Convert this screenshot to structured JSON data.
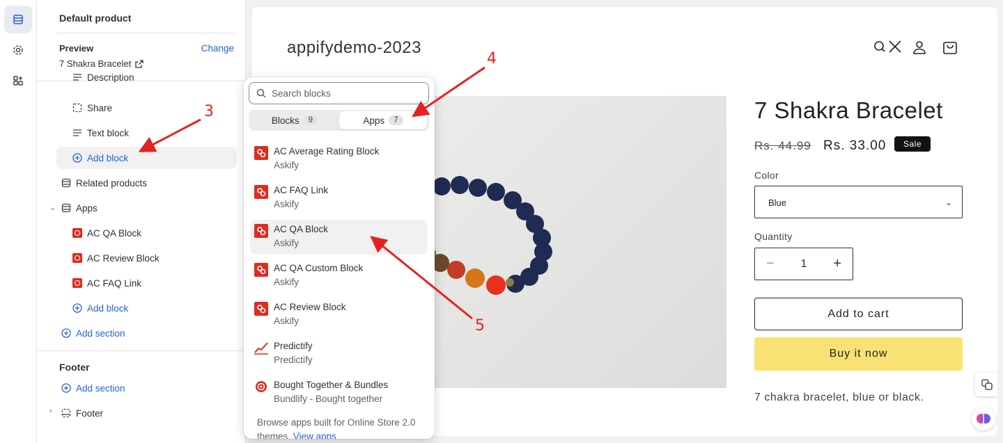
{
  "sidebar": {
    "title": "Default product",
    "preview_label": "Preview",
    "change_label": "Change",
    "preview_value": "7 Shakra Bracelet",
    "items": {
      "description": "Description",
      "share": "Share",
      "text_block": "Text block",
      "add_block_1": "Add block",
      "related_products": "Related products",
      "apps": "Apps",
      "ac_qa_block": "AC QA Block",
      "ac_review_block": "AC Review Block",
      "ac_faq_link": "AC FAQ Link",
      "add_block_2": "Add block",
      "add_section_1": "Add section"
    },
    "footer_title": "Footer",
    "footer_add_section": "Add section",
    "footer_item": "Footer"
  },
  "popover": {
    "search_placeholder": "Search blocks",
    "tabs": [
      {
        "label": "Blocks",
        "count": "9"
      },
      {
        "label": "Apps",
        "count": "7"
      }
    ],
    "active_tab": "Apps",
    "items": [
      {
        "name": "AC Average Rating Block",
        "vendor": "Askify"
      },
      {
        "name": "AC FAQ Link",
        "vendor": "Askify"
      },
      {
        "name": "AC QA Block",
        "vendor": "Askify"
      },
      {
        "name": "AC QA Custom Block",
        "vendor": "Askify"
      },
      {
        "name": "AC Review Block",
        "vendor": "Askify"
      },
      {
        "name": "Predictify",
        "vendor": "Predictify"
      },
      {
        "name": "Bought Together & Bundles",
        "vendor": "Bundlify - Bought together"
      }
    ],
    "footer_text": "Browse apps built for Online Store 2.0 themes.",
    "footer_link": "View apps"
  },
  "store": {
    "brand": "appifydemo-2023",
    "product_title": "7 Shakra Bracelet",
    "old_price": "Rs. 44.99",
    "new_price": "Rs. 33.00",
    "sale_badge": "Sale",
    "color_label": "Color",
    "color_value": "Blue",
    "quantity_label": "Quantity",
    "quantity_value": "1",
    "add_to_cart": "Add to cart",
    "buy_now": "Buy it now",
    "description": "7 chakra bracelet, blue or black."
  },
  "annotations": [
    "3",
    "4",
    "5"
  ],
  "colors": {
    "accent_blue": "#2463d1",
    "app_icon_red": "#e02b1e",
    "annotation_red": "#e52222",
    "buy_button": "#f8e274"
  }
}
